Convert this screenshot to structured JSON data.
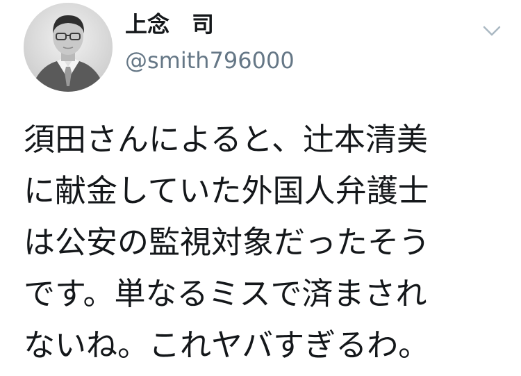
{
  "tweet": {
    "display_name": "上念　司",
    "handle": "@smith796000",
    "menu_icon": "chevron-down-icon",
    "avatar_icon": "profile-photo",
    "text_lines": [
      "須田さんによると、辻本清美",
      "に献金していた外国人弁護士",
      "は公安の監視対象だったそう",
      "です。単なるミスで済まされ",
      "ないね。これヤバすぎるわ。"
    ]
  },
  "colors": {
    "name": "#14171a",
    "handle": "#657786",
    "chevron": "#aab8c2",
    "background": "#ffffff"
  }
}
